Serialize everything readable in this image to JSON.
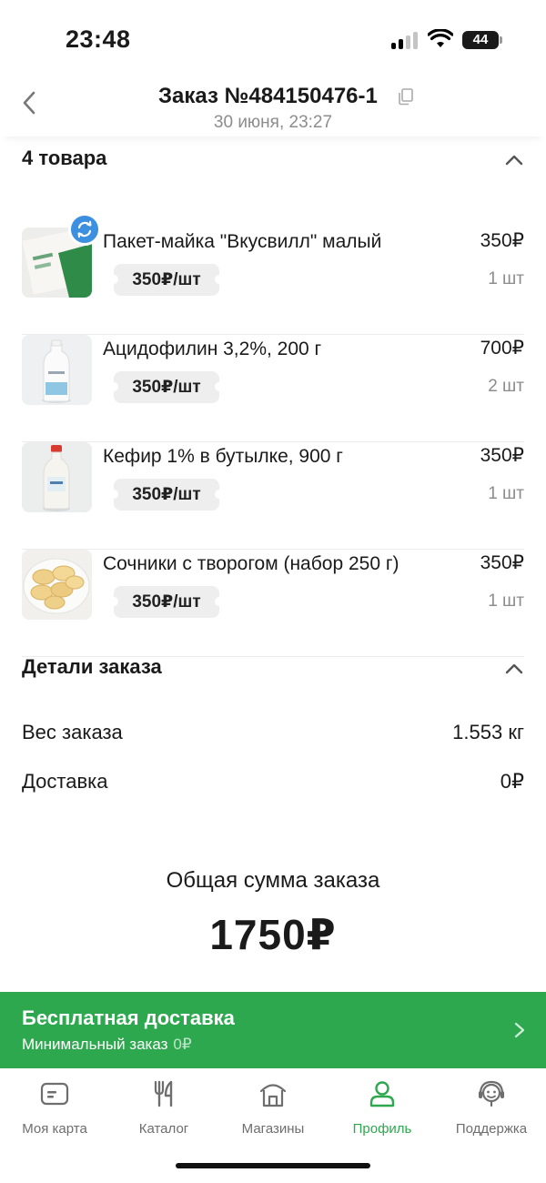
{
  "status_bar": {
    "time": "23:48",
    "battery": "44"
  },
  "header": {
    "title": "Заказ №484150476-1",
    "date": "30 июня, 23:27"
  },
  "items_section": {
    "title": "4 товара"
  },
  "items": [
    {
      "name": "Пакет-майка \"Вкусвилл\" малый",
      "unit_price": "350₽/шт",
      "total": "350₽",
      "qty": "1 шт",
      "thumb_icon": "paper-bag-thumbnail"
    },
    {
      "name": "Ацидофилин 3,2%, 200 г",
      "unit_price": "350₽/шт",
      "total": "700₽",
      "qty": "2 шт",
      "thumb_icon": "small-bottle-thumbnail"
    },
    {
      "name": "Кефир 1% в бутылке, 900 г",
      "unit_price": "350₽/шт",
      "total": "350₽",
      "qty": "1 шт",
      "thumb_icon": "kefir-bottle-thumbnail"
    },
    {
      "name": "Сочники с творогом (набор 250 г)",
      "unit_price": "350₽/шт",
      "total": "350₽",
      "qty": "1 шт",
      "thumb_icon": "pastry-plate-thumbnail"
    }
  ],
  "details_section": {
    "title": "Детали заказа",
    "rows": [
      {
        "label": "Вес заказа",
        "value": "1.553 кг"
      },
      {
        "label": "Доставка",
        "value": "0₽"
      }
    ]
  },
  "summary": {
    "label": "Общая сумма заказа",
    "value": "1750₽"
  },
  "promo": {
    "title": "Бесплатная доставка",
    "subtitle_label": "Минимальный заказ",
    "subtitle_value": "0₽"
  },
  "tabs": [
    {
      "label": "Моя карта",
      "icon": "card-icon"
    },
    {
      "label": "Каталог",
      "icon": "fork-knife-icon"
    },
    {
      "label": "Магазины",
      "icon": "store-icon"
    },
    {
      "label": "Профиль",
      "icon": "profile-icon",
      "active": true
    },
    {
      "label": "Поддержка",
      "icon": "support-icon"
    }
  ],
  "colors": {
    "accent": "#2ea84f",
    "badge": "#3d8fe0",
    "muted": "#8c8c8c"
  }
}
